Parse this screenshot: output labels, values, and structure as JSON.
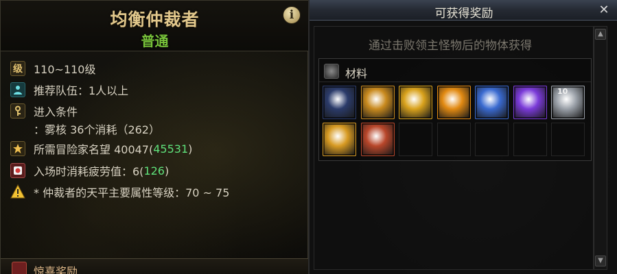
{
  "left_panel": {
    "title": "均衡仲裁者",
    "difficulty": "普通",
    "rows": {
      "level": "110~110级",
      "party": "推荐队伍：1人以上",
      "entry_label": "进入条件",
      "entry_detail": "：雾核 36个消耗（262）",
      "fame_label": "所需冒险家名望 40047(",
      "fame_value": "45531",
      "fame_close": ")",
      "fatigue_label": "入场时消耗疲劳值：6(",
      "fatigue_value": "126",
      "fatigue_close": ")",
      "warning": "* 仲裁者的天平主要属性等级：70 ~ 75"
    },
    "bonus_label": "惊喜奖励",
    "icons": {
      "info": "info-icon",
      "level": "level-icon",
      "party": "party-icon",
      "key": "key-icon",
      "fame": "fame-icon",
      "fatigue": "fatigue-icon",
      "warning": "warning-icon"
    }
  },
  "right_panel": {
    "title": "可获得奖励",
    "close": "✕",
    "description": "通过击败领主怪物后的物体获得",
    "category": "材料",
    "lock_badge": "10",
    "items": [
      {
        "name": "blue-orb-item",
        "color": "#2b3b6a"
      },
      {
        "name": "gold-blue-crystal-item",
        "color": "#c98a1e"
      },
      {
        "name": "gold-ticket-item",
        "color": "#d9a21c"
      },
      {
        "name": "orange-gem-item",
        "color": "#e28a12"
      },
      {
        "name": "blue-cube-item",
        "color": "#3a6ad0"
      },
      {
        "name": "purple-cube-item",
        "color": "#7a3ad8"
      },
      {
        "name": "silver-cube-item",
        "color": "#9aa0a8"
      },
      {
        "name": "gold-chest-item",
        "color": "#d79a22"
      },
      {
        "name": "red-box-item",
        "color": "#b8462a"
      }
    ]
  }
}
